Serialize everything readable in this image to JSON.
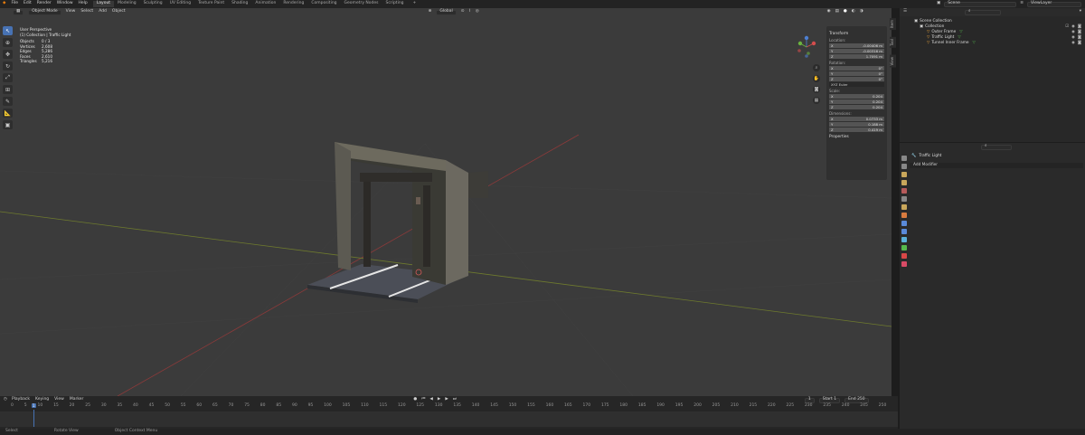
{
  "topbar": {
    "menu": [
      "File",
      "Edit",
      "Render",
      "Window",
      "Help"
    ],
    "workspaces": [
      {
        "label": "Layout",
        "active": true
      },
      {
        "label": "Modeling"
      },
      {
        "label": "Sculpting"
      },
      {
        "label": "UV Editing"
      },
      {
        "label": "Texture Paint"
      },
      {
        "label": "Shading"
      },
      {
        "label": "Animation"
      },
      {
        "label": "Rendering"
      },
      {
        "label": "Compositing"
      },
      {
        "label": "Geometry Nodes"
      },
      {
        "label": "Scripting"
      }
    ],
    "add_tab": "+",
    "scene": "Scene",
    "view_layer": "ViewLayer"
  },
  "viewport": {
    "mode": "Object Mode",
    "menus": [
      "View",
      "Select",
      "Add",
      "Object"
    ],
    "orientation": "Global",
    "options": "Options",
    "overlay": {
      "perspective": "User Perspective",
      "collection": "(1) Collection | Traffic Light",
      "stats": [
        {
          "k": "Objects",
          "v": "0 / 3"
        },
        {
          "k": "Vertices",
          "v": "2,608"
        },
        {
          "k": "Edges",
          "v": "5,286"
        },
        {
          "k": "Faces",
          "v": "2,610"
        },
        {
          "k": "Triangles",
          "v": "5,216"
        }
      ]
    },
    "side_tabs": [
      "Item",
      "Tool",
      "View"
    ]
  },
  "npanel": {
    "transform": "Transform",
    "location_label": "Location:",
    "location": [
      {
        "a": "X",
        "v": "-0.00406 m"
      },
      {
        "a": "Y",
        "v": "-0.00316 m"
      },
      {
        "a": "Z",
        "v": "1.7091 m"
      }
    ],
    "rotation_label": "Rotation:",
    "rotation": [
      {
        "a": "X",
        "v": "0°"
      },
      {
        "a": "Y",
        "v": "0°"
      },
      {
        "a": "Z",
        "v": "0°"
      }
    ],
    "rotation_mode": "XYZ Euler",
    "scale_label": "Scale:",
    "scale": [
      {
        "a": "X",
        "v": "0.204"
      },
      {
        "a": "Y",
        "v": "0.204"
      },
      {
        "a": "Z",
        "v": "0.204"
      }
    ],
    "dimensions_label": "Dimensions:",
    "dimensions": [
      {
        "a": "X",
        "v": "0.0733 m"
      },
      {
        "a": "Y",
        "v": "0.188 m"
      },
      {
        "a": "Z",
        "v": "0.419 m"
      }
    ],
    "properties": "Properties"
  },
  "timeline": {
    "menus": [
      "Playback",
      "Keying",
      "View",
      "Marker"
    ],
    "current_frame": "1",
    "start_label": "Start",
    "start": "1",
    "end_label": "End",
    "end": "250",
    "ruler": [
      "0",
      "5",
      "10",
      "15",
      "20",
      "25",
      "30",
      "35",
      "40",
      "45",
      "50",
      "55",
      "60",
      "65",
      "70",
      "75",
      "80",
      "85",
      "90",
      "95",
      "100",
      "105",
      "110",
      "115",
      "120",
      "125",
      "130",
      "135",
      "140",
      "145",
      "150",
      "155",
      "160",
      "165",
      "170",
      "175",
      "180",
      "185",
      "190",
      "195",
      "200",
      "205",
      "210",
      "215",
      "220",
      "225",
      "230",
      "235",
      "240",
      "245",
      "250"
    ],
    "playhead_frame": "1"
  },
  "statusbar": {
    "items": [
      "Select",
      "Rotate View",
      "Object Context Menu"
    ]
  },
  "outliner": {
    "root": "Scene Collection",
    "collection": "Collection",
    "items": [
      "Outer Frame",
      "Traffic Light",
      "Tunnel Inner Frame"
    ]
  },
  "properties": {
    "object_name": "Traffic Light",
    "add_modifier": "Add Modifier",
    "tab_colors": [
      "#888888",
      "#888888",
      "#c9a75b",
      "#c9a75b",
      "#b65a5a",
      "#888888",
      "#c9a75b",
      "#d97b3f",
      "#5a8ad9",
      "#5a8ad9",
      "#5ab0d9",
      "#56b94d",
      "#d94747",
      "#d94b66"
    ]
  }
}
